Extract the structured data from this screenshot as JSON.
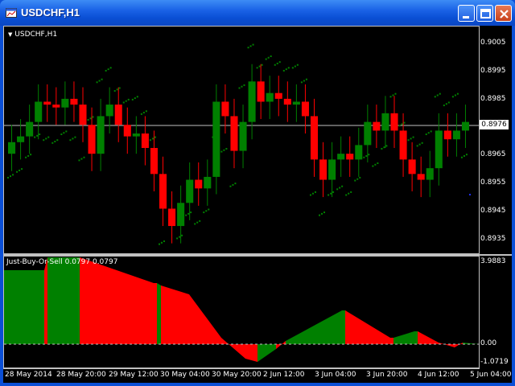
{
  "window": {
    "title": "USDCHF,H1",
    "colors": {
      "titlebar": "#0a4fd4",
      "chart_bg": "#000000",
      "bull": "#008000",
      "bear": "#ff0000",
      "grid": "#c0c0c0"
    }
  },
  "price_chart": {
    "symbol_label": "USDCHF,H1",
    "current_price": "0.8976",
    "y_labels": [
      "0.9005",
      "0.8995",
      "0.8985",
      "0.8965",
      "0.8955",
      "0.8945",
      "0.8935"
    ]
  },
  "indicator": {
    "label": "Just-Buy-Or-Sell 0.0797 0.0797",
    "y_labels": [
      "3.9883",
      "0.00",
      "-1.0719"
    ]
  },
  "time_axis": {
    "labels": [
      "28 May 2014",
      "28 May 20:00",
      "29 May 12:00",
      "30 May 04:00",
      "30 May 20:00",
      "2 Jun 12:00",
      "3 Jun 04:00",
      "3 Jun 20:00",
      "4 Jun 12:00",
      "5 Jun 04:00"
    ]
  },
  "chart_data": [
    {
      "type": "candlestick",
      "title": "USDCHF,H1",
      "ylim": [
        0.8932,
        0.9011
      ],
      "current_price": 0.8976,
      "series": [
        {
          "name": "close",
          "values": [
            0.8971,
            0.8973,
            0.8978,
            0.8985,
            0.8984,
            0.8983,
            0.8986,
            0.8984,
            0.8977,
            0.8967,
            0.898,
            0.8984,
            0.8977,
            0.8973,
            0.8974,
            0.8969,
            0.896,
            0.8948,
            0.8942,
            0.895,
            0.8958,
            0.8955,
            0.8959,
            0.8985,
            0.898,
            0.8968,
            0.8978,
            0.8992,
            0.8985,
            0.8988,
            0.8986,
            0.8984,
            0.8985,
            0.898,
            0.8965,
            0.8958,
            0.8965,
            0.8967,
            0.8965,
            0.897,
            0.8978,
            0.8975,
            0.8981,
            0.8975,
            0.8965,
            0.896,
            0.8958,
            0.8962,
            0.8975,
            0.8972,
            0.8975,
            0.8978
          ]
        }
      ]
    },
    {
      "type": "area",
      "title": "Just-Buy-Or-Sell",
      "ylim": [
        -1.0719,
        3.9883
      ],
      "zero_line": 0.0
    }
  ]
}
